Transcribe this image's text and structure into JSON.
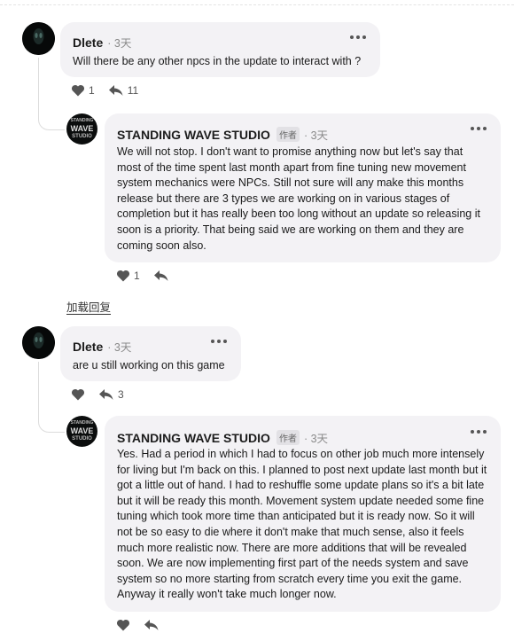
{
  "comments": [
    {
      "author": "Dlete",
      "time": "· 3天",
      "text": "Will there be any other npcs in the update to interact with ?",
      "likes": "1",
      "replies": "11"
    },
    {
      "author": "STANDING WAVE STUDIO",
      "badge": "作者",
      "time": "· 3天",
      "text": "We will not stop. I don't want to promise anything now but let's say that most of the time spent last month apart from fine tuning new movement system mechanics were NPCs. Still not sure will any make this months release but there are 3 types we are working on in various stages of completion but it has really been too long without an update so releasing it soon is a priority. That being said we are working on them and they are coming soon also.",
      "likes": "1"
    },
    {
      "author": "Dlete",
      "time": "· 3天",
      "text": "are u still working on this game",
      "replies": "3"
    },
    {
      "author": "STANDING WAVE STUDIO",
      "badge": "作者",
      "time": "· 3天",
      "text": "Yes. Had a period in which I had to focus on other job much more intensely for living but I'm back on this. I planned to post next update last month but it got a little out of hand. I had to reshuffle some update plans so it's a bit late but it will be ready this month. Movement system update needed some fine tuning which took more time than anticipated but it is ready now. So it will not be so easy to die where it don't make that much sense, also it feels much more realistic now. There are more additions that will be revealed soon. We are now implementing first part of the needs system and save system so no more starting from scratch every time you exit the game. Anyway it really won't take much longer now."
    }
  ],
  "load_more": "加载回复",
  "studio_logo": {
    "line1": "STANDING",
    "line2": "WAVE",
    "line3": "STUDIO"
  },
  "icons": {
    "like": "heart-icon",
    "reply": "reply-arrow-icon",
    "more": "more-options-icon"
  },
  "colors": {
    "bubble": "#f3f2f5",
    "thread_line": "#dcdcdc",
    "icon": "#555555"
  }
}
